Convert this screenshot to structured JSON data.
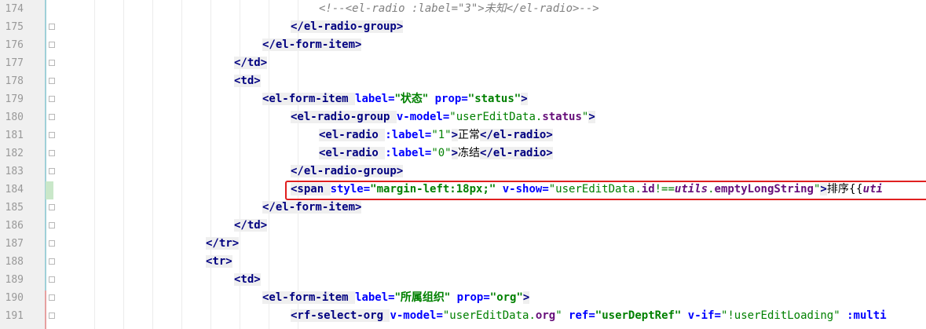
{
  "editor": {
    "lines": [
      {
        "n": "174",
        "tokens": [
          {
            "t": "<!--<el-radio :label=\"3\">",
            "c": "comment"
          },
          {
            "t": "未知",
            "c": "comment cn"
          },
          {
            "t": "</el-radio>-->",
            "c": "comment"
          }
        ]
      },
      {
        "n": "175",
        "tokens": [
          {
            "t": "</el-radio-group>",
            "c": "tag"
          }
        ]
      },
      {
        "n": "176",
        "tokens": [
          {
            "t": "</el-form-item>",
            "c": "tag"
          }
        ]
      },
      {
        "n": "177",
        "tokens": [
          {
            "t": "</td>",
            "c": "tag"
          }
        ]
      },
      {
        "n": "178",
        "tokens": [
          {
            "t": "<td>",
            "c": "tag"
          }
        ]
      },
      {
        "n": "179",
        "tokens": [
          {
            "t": "<el-form-item ",
            "c": "tag"
          },
          {
            "t": "label=",
            "c": "attr"
          },
          {
            "t": "\"状态\"",
            "c": "val cn"
          },
          {
            "t": " prop=",
            "c": "attr"
          },
          {
            "t": "\"status\"",
            "c": "val"
          },
          {
            "t": ">",
            "c": "tag"
          }
        ]
      },
      {
        "n": "180",
        "tokens": [
          {
            "t": "<el-radio-group ",
            "c": "tag"
          },
          {
            "t": "v-model=",
            "c": "attr"
          },
          {
            "t": "\"userEditData.",
            "c": "valplain"
          },
          {
            "t": "status",
            "c": "field"
          },
          {
            "t": "\"",
            "c": "valplain"
          },
          {
            "t": ">",
            "c": "tag"
          }
        ]
      },
      {
        "n": "181",
        "tokens": [
          {
            "t": "<el-radio ",
            "c": "tag"
          },
          {
            "t": ":label=",
            "c": "attr"
          },
          {
            "t": "\"1\"",
            "c": "valplain"
          },
          {
            "t": ">",
            "c": "tag"
          },
          {
            "t": "正常",
            "c": "plain cn"
          },
          {
            "t": "</el-radio>",
            "c": "tag"
          }
        ]
      },
      {
        "n": "182",
        "tokens": [
          {
            "t": "<el-radio ",
            "c": "tag"
          },
          {
            "t": ":label=",
            "c": "attr"
          },
          {
            "t": "\"0\"",
            "c": "valplain"
          },
          {
            "t": ">",
            "c": "tag"
          },
          {
            "t": "冻结",
            "c": "plain cn"
          },
          {
            "t": "</el-radio>",
            "c": "tag"
          }
        ]
      },
      {
        "n": "183",
        "tokens": [
          {
            "t": "</el-radio-group>",
            "c": "tag"
          }
        ]
      },
      {
        "n": "184",
        "tokens": [
          {
            "t": "<span ",
            "c": "tag"
          },
          {
            "t": "style=",
            "c": "attr"
          },
          {
            "t": "\"margin-left:18px;\"",
            "c": "val"
          },
          {
            "t": " v-show=",
            "c": "attr"
          },
          {
            "t": "\"userEditData.",
            "c": "valplain"
          },
          {
            "t": "id",
            "c": "field"
          },
          {
            "t": "!==",
            "c": "valplain"
          },
          {
            "t": "utils",
            "c": "italicfield"
          },
          {
            "t": ".",
            "c": "valplain"
          },
          {
            "t": "emptyLongString",
            "c": "field"
          },
          {
            "t": "\"",
            "c": "valplain"
          },
          {
            "t": ">",
            "c": "tag"
          },
          {
            "t": "排序{{",
            "c": "plain cn"
          },
          {
            "t": "uti",
            "c": "italicfield"
          }
        ]
      },
      {
        "n": "185",
        "tokens": [
          {
            "t": "</el-form-item>",
            "c": "tag"
          }
        ]
      },
      {
        "n": "186",
        "tokens": [
          {
            "t": "</td>",
            "c": "tag"
          }
        ]
      },
      {
        "n": "187",
        "tokens": [
          {
            "t": "</tr>",
            "c": "tag"
          }
        ]
      },
      {
        "n": "188",
        "tokens": [
          {
            "t": "<tr>",
            "c": "tag"
          }
        ]
      },
      {
        "n": "189",
        "tokens": [
          {
            "t": "<td>",
            "c": "tag"
          }
        ]
      },
      {
        "n": "190",
        "tokens": [
          {
            "t": "<el-form-item ",
            "c": "tag"
          },
          {
            "t": "label=",
            "c": "attr"
          },
          {
            "t": "\"所属组织\"",
            "c": "val cn"
          },
          {
            "t": " prop=",
            "c": "attr"
          },
          {
            "t": "\"org\"",
            "c": "val"
          },
          {
            "t": ">",
            "c": "tag"
          }
        ]
      },
      {
        "n": "191",
        "tokens": [
          {
            "t": "<rf-select-org ",
            "c": "tag"
          },
          {
            "t": "v-model=",
            "c": "attr"
          },
          {
            "t": "\"userEditData.",
            "c": "valplain"
          },
          {
            "t": "org",
            "c": "field"
          },
          {
            "t": "\"",
            "c": "valplain"
          },
          {
            "t": " ref=",
            "c": "attr"
          },
          {
            "t": "\"userDeptRef\"",
            "c": "val"
          },
          {
            "t": " v-if=",
            "c": "attr"
          },
          {
            "t": "\"!userEditLoading\"",
            "c": "valplain"
          },
          {
            "t": " :multi",
            "c": "attr"
          }
        ]
      }
    ]
  },
  "colors": {
    "highlight_border": "#e02020",
    "tag": "#000080",
    "attribute": "#0000ff",
    "value": "#008000",
    "comment": "#808080"
  }
}
